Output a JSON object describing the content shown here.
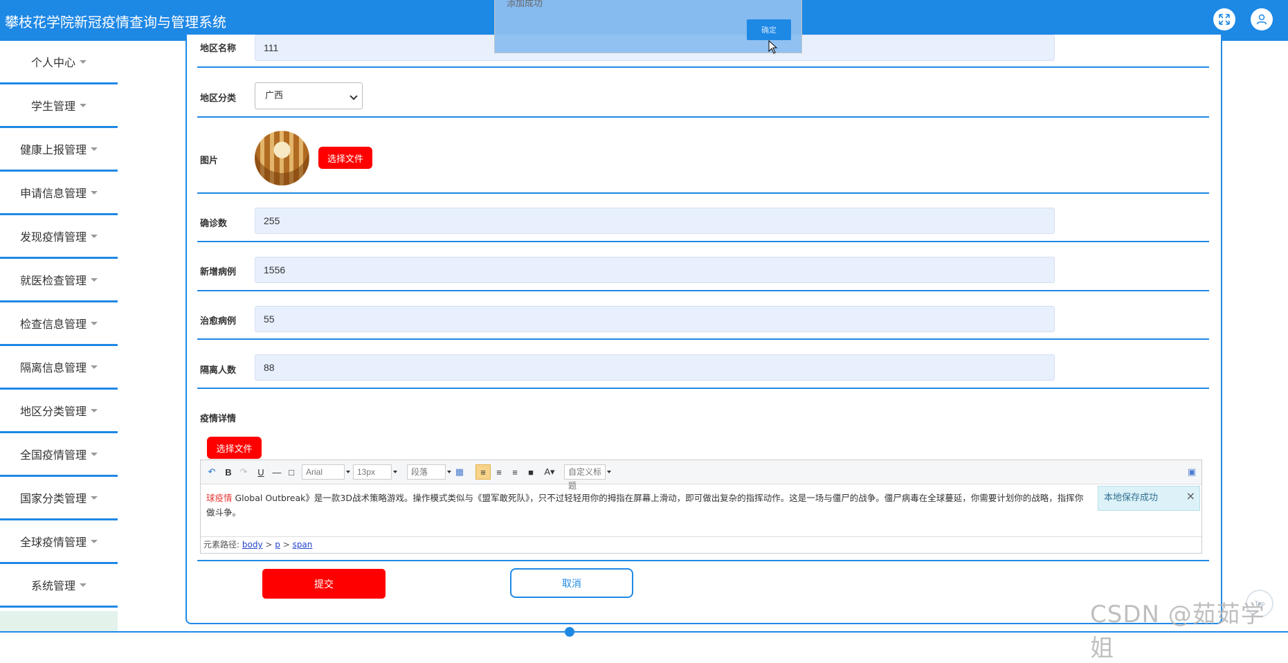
{
  "app": {
    "title": "攀枝花学院新冠疫情查询与管理系统",
    "accent_color": "#1e88e5",
    "header_icons": [
      "fullscreen-icon",
      "user-icon"
    ]
  },
  "dialog": {
    "message": "添加成功",
    "ok_label": "确定"
  },
  "sidebar": {
    "items": [
      {
        "label": "个人中心"
      },
      {
        "label": "学生管理"
      },
      {
        "label": "健康上报管理"
      },
      {
        "label": "申请信息管理"
      },
      {
        "label": "发现疫情管理"
      },
      {
        "label": "就医检查管理"
      },
      {
        "label": "检查信息管理"
      },
      {
        "label": "隔离信息管理"
      },
      {
        "label": "地区分类管理"
      },
      {
        "label": "全国疫情管理"
      },
      {
        "label": "国家分类管理"
      },
      {
        "label": "全球疫情管理"
      },
      {
        "label": "系统管理"
      }
    ]
  },
  "form": {
    "region_name": {
      "label": "地区名称",
      "value": "111"
    },
    "region_category": {
      "label": "地区分类",
      "value": "广西"
    },
    "image": {
      "label": "图片",
      "choose_label": "选择文件"
    },
    "confirmed": {
      "label": "确诊数",
      "value": "255"
    },
    "new_cases": {
      "label": "新增病例",
      "value": "1556"
    },
    "recovered": {
      "label": "治愈病例",
      "value": "55"
    },
    "quarantined": {
      "label": "隔离人数",
      "value": "88"
    },
    "details": {
      "label": "疫情详情",
      "choose_label": "选择文件"
    }
  },
  "editor": {
    "toolbar": {
      "font": "Arial",
      "size": "13px",
      "paragraph": "段落",
      "custom_title": "自定义标题"
    },
    "content_red": "球疫情",
    "content": " Global Outbreak》是一款3D战术策略游戏。操作模式类似与《盟军敢死队》，只不过轻轻用你的拇指在屏幕上滑动，即可做出复杂的指挥动作。这是一场与僵尸的战争。僵尸病毒在全球蔓延，你需要计划你的战略，指挥你",
    "content_line2": "做斗争。",
    "path_label": "元素路径:",
    "path": [
      "body",
      "p",
      "span"
    ],
    "toast": "本地保存成功"
  },
  "actions": {
    "submit_label": "提交",
    "cancel_label": "取消"
  },
  "watermark": "CSDN @茹茹学姐",
  "top_widget_label": "Top"
}
